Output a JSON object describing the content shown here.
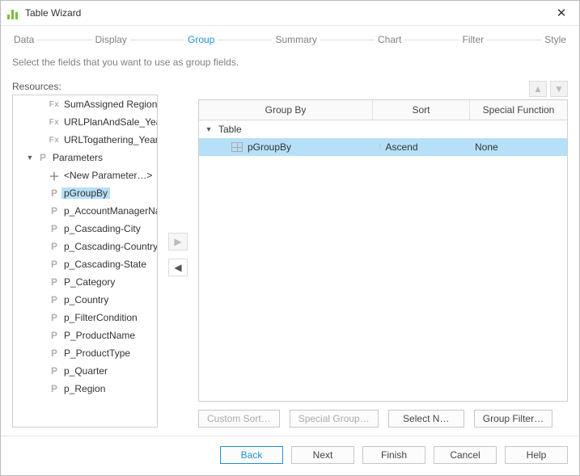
{
  "window": {
    "title": "Table Wizard"
  },
  "steps": {
    "items": [
      {
        "label": "Data",
        "active": false
      },
      {
        "label": "Display",
        "active": false
      },
      {
        "label": "Group",
        "active": true
      },
      {
        "label": "Summary",
        "active": false
      },
      {
        "label": "Chart",
        "active": false
      },
      {
        "label": "Filter",
        "active": false
      },
      {
        "label": "Style",
        "active": false
      }
    ]
  },
  "instruction": "Select the fields that you want to use as group fields.",
  "resources": {
    "label": "Resources:",
    "tree": [
      {
        "depth": 2,
        "caret": "",
        "iconType": "fx",
        "iconText": "Fx",
        "label": "SumAssigned Region",
        "selected": false
      },
      {
        "depth": 2,
        "caret": "",
        "iconType": "fx",
        "iconText": "Fx",
        "label": "URLPlanAndSale_Year",
        "selected": false
      },
      {
        "depth": 2,
        "caret": "",
        "iconType": "fx",
        "iconText": "Fx",
        "label": "URLTogathering_Year",
        "selected": false
      },
      {
        "depth": 1,
        "caret": "▾",
        "iconType": "p",
        "iconText": "P",
        "label": "Parameters",
        "selected": false
      },
      {
        "depth": 2,
        "caret": "",
        "iconType": "plus",
        "iconText": "＋",
        "label": "<New Parameter…>",
        "selected": false
      },
      {
        "depth": 2,
        "caret": "",
        "iconType": "p",
        "iconText": "P",
        "label": "pGroupBy",
        "selected": true
      },
      {
        "depth": 2,
        "caret": "",
        "iconType": "p",
        "iconText": "P",
        "label": "p_AccountManagerName",
        "selected": false
      },
      {
        "depth": 2,
        "caret": "",
        "iconType": "p",
        "iconText": "P",
        "label": "p_Cascading-City",
        "selected": false
      },
      {
        "depth": 2,
        "caret": "",
        "iconType": "p",
        "iconText": "P",
        "label": "p_Cascading-Country",
        "selected": false
      },
      {
        "depth": 2,
        "caret": "",
        "iconType": "p",
        "iconText": "P",
        "label": "p_Cascading-State",
        "selected": false
      },
      {
        "depth": 2,
        "caret": "",
        "iconType": "p",
        "iconText": "P",
        "label": "P_Category",
        "selected": false
      },
      {
        "depth": 2,
        "caret": "",
        "iconType": "p",
        "iconText": "P",
        "label": "p_Country",
        "selected": false
      },
      {
        "depth": 2,
        "caret": "",
        "iconType": "p",
        "iconText": "P",
        "label": "p_FilterCondition",
        "selected": false
      },
      {
        "depth": 2,
        "caret": "",
        "iconType": "p",
        "iconText": "P",
        "label": "P_ProductName",
        "selected": false
      },
      {
        "depth": 2,
        "caret": "",
        "iconType": "p",
        "iconText": "P",
        "label": "P_ProductType",
        "selected": false
      },
      {
        "depth": 2,
        "caret": "",
        "iconType": "p",
        "iconText": "P",
        "label": "p_Quarter",
        "selected": false
      },
      {
        "depth": 2,
        "caret": "",
        "iconType": "p",
        "iconText": "P",
        "label": "p_Region",
        "selected": false
      }
    ]
  },
  "grid": {
    "headers": {
      "group": "Group By",
      "sort": "Sort",
      "spec": "Special Function"
    },
    "rows": [
      {
        "caret": "▾",
        "icon": "",
        "label": "Table",
        "sort": "",
        "spec": "",
        "selected": false,
        "indent": 0
      },
      {
        "caret": "",
        "icon": "table",
        "label": "pGroupBy",
        "sort": "Ascend",
        "sortdir": "↑",
        "spec": "None",
        "selected": true,
        "indent": 1
      }
    ]
  },
  "actions": {
    "customSort": "Custom Sort…",
    "specialGroup": "Special Group…",
    "selectN": "Select N…",
    "groupFilter": "Group Filter…"
  },
  "footer": {
    "back": "Back",
    "next": "Next",
    "finish": "Finish",
    "cancel": "Cancel",
    "help": "Help"
  }
}
